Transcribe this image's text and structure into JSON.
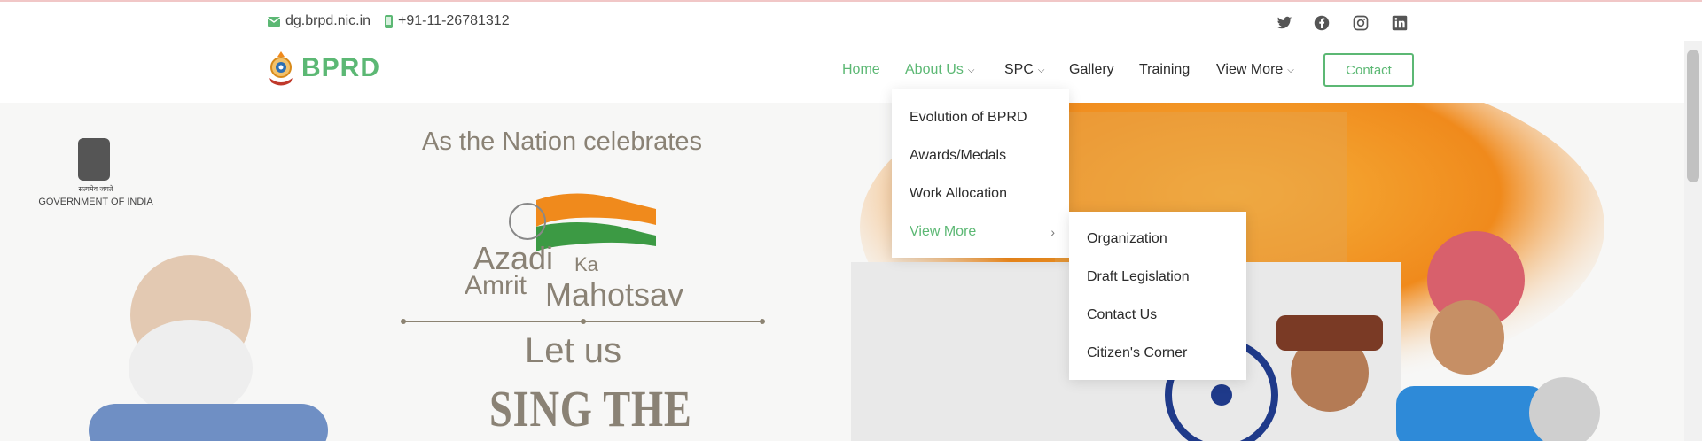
{
  "topbar": {
    "email": "dg.brpd.nic.in",
    "phone": "+91-11-26781312",
    "social_icons": [
      "twitter-icon",
      "facebook-icon",
      "instagram-icon",
      "linkedin-icon"
    ]
  },
  "header": {
    "logo_text": "BPRD",
    "nav": [
      {
        "label": "Home",
        "active": true
      },
      {
        "label": "About Us",
        "dropdown": true
      },
      {
        "label": "SPC",
        "dropdown": true
      },
      {
        "label": "Gallery"
      },
      {
        "label": "Training"
      },
      {
        "label": "View More",
        "dropdown": true
      }
    ],
    "contact_button": "Contact"
  },
  "about_dropdown": {
    "items": [
      {
        "label": "Evolution of BPRD"
      },
      {
        "label": "Awards/Medals"
      },
      {
        "label": "Work Allocation"
      },
      {
        "label": "View More",
        "active": true,
        "submenu": true
      }
    ]
  },
  "submenu": {
    "items": [
      {
        "label": "Organization"
      },
      {
        "label": "Draft Legislation"
      },
      {
        "label": "Contact Us"
      },
      {
        "label": "Citizen's Corner"
      }
    ]
  },
  "hero": {
    "emblem_caption": "GOVERNMENT OF INDIA",
    "emblem_motto": "सत्यमेव जयते",
    "headline": "As the Nation celebrates",
    "logo_line1": "Azadi",
    "logo_ka": "Ka",
    "logo_line2": "Amrit",
    "logo_mahotsav": "Mahotsav",
    "let_us": "Let us",
    "sing_the": "SING THE"
  },
  "colors": {
    "accent": "#5cb874",
    "saffron": "#f08a1c",
    "navy": "#1f3a8a"
  }
}
